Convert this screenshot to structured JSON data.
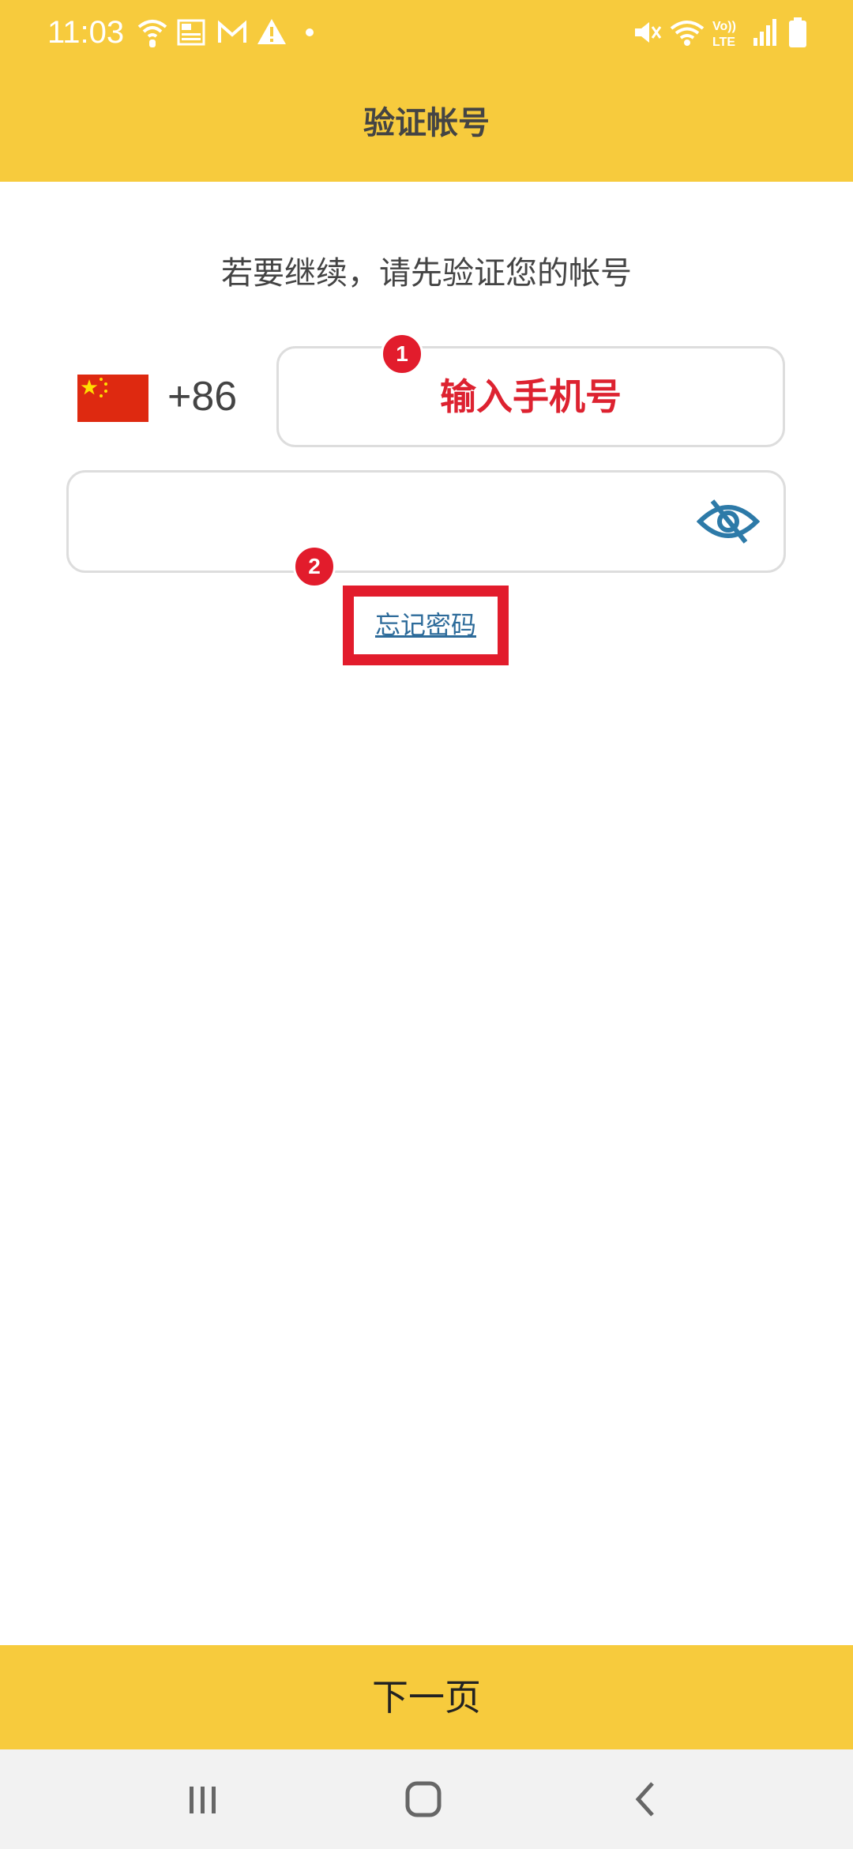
{
  "status_bar": {
    "time": "11:03",
    "icons": [
      "wifi-calling-icon",
      "news-icon",
      "gmail-icon",
      "warning-icon",
      "dot-icon",
      "mute-icon",
      "wifi-icon",
      "volte-icon",
      "signal-icon",
      "battery-icon"
    ]
  },
  "app_bar": {
    "title": "验证帐号"
  },
  "main": {
    "subtitle": "若要继续，请先验证您的帐号",
    "country_code": "+86",
    "phone_placeholder": "输入手机号",
    "forgot_password": "忘记密码",
    "badges": [
      "1",
      "2"
    ]
  },
  "footer": {
    "next_label": "下一页"
  },
  "colors": {
    "accent": "#f7cb3d",
    "highlight": "#e21c2c",
    "link": "#2d6b9a"
  }
}
